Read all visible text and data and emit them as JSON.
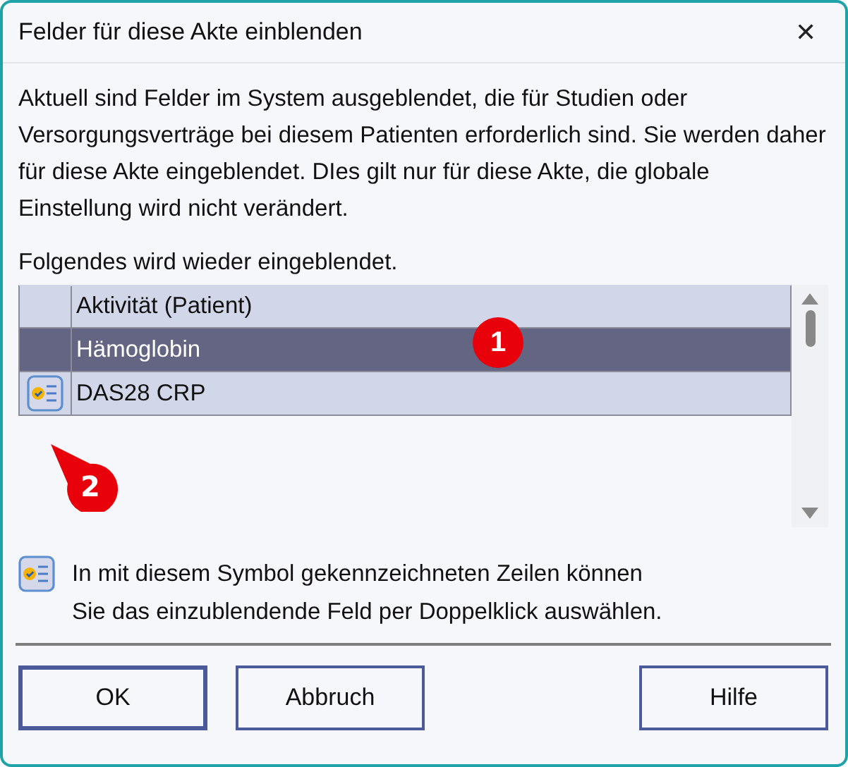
{
  "window": {
    "title": "Felder für diese Akte einblenden",
    "close": "✕"
  },
  "message": "Aktuell sind Felder im System ausgeblendet, die für Studien oder Versorgungsverträge bei diesem Patienten erforderlich sind. Sie werden daher für diese Akte eingeblendet. DIes gilt nur für diese Akte, die globale Einstellung wird nicht verändert.",
  "list_caption": "Folgendes wird wieder eingeblendet.",
  "rows": [
    {
      "label": "Aktivität (Patient)",
      "selected": false,
      "selectable_icon": false
    },
    {
      "label": "Hämoglobin",
      "selected": true,
      "selectable_icon": false
    },
    {
      "label": "DAS28 CRP",
      "selected": false,
      "selectable_icon": true
    }
  ],
  "legend": [
    "In mit diesem Symbol gekennzeichneten Zeilen können",
    "Sie das einzublendende Feld per Doppelklick auswählen."
  ],
  "buttons": [
    {
      "label": "OK",
      "default": true
    },
    {
      "label": "Abbruch",
      "default": false
    },
    {
      "label": "Hilfe",
      "default": false
    }
  ],
  "callouts": [
    {
      "label": "1"
    },
    {
      "label": "2"
    }
  ]
}
